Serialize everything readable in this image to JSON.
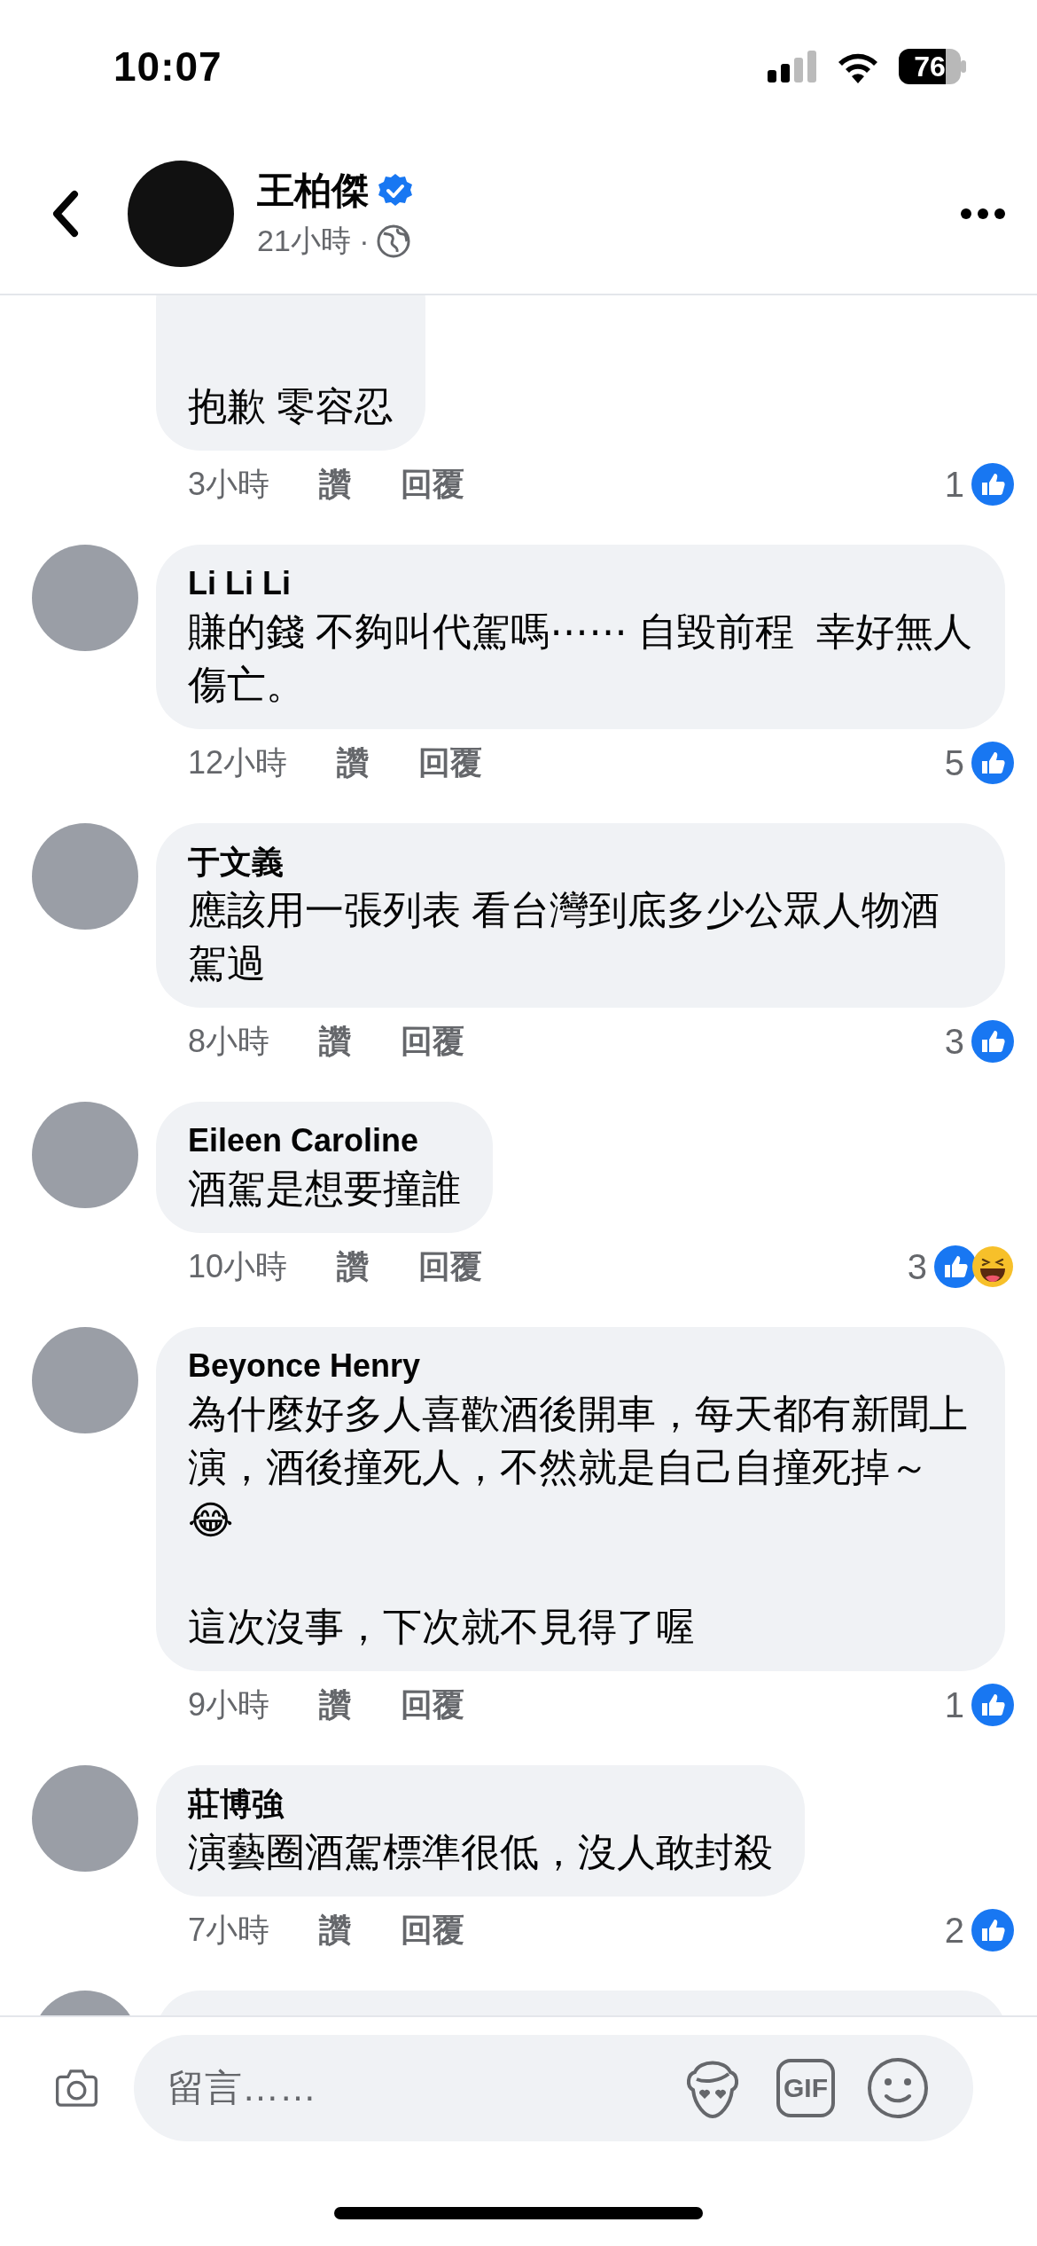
{
  "status_bar": {
    "time": "10:07",
    "battery": "76"
  },
  "post_header": {
    "author": "王柏傑",
    "verified": true,
    "time": "21小時 ·"
  },
  "comments": [
    {
      "kind": "cut_top",
      "text": "抱歉 零容忍",
      "time": "3小時",
      "like_label": "讚",
      "reply_label": "回覆",
      "reaction_count": "1",
      "reactions": [
        {
          "kind": "like"
        }
      ]
    },
    {
      "kind": "comment",
      "author": "Li Li Li",
      "text": "賺的錢 不夠叫代駕嗎⋯⋯ 自毀前程  幸好無人傷亡。",
      "time": "12小時",
      "like_label": "讚",
      "reply_label": "回覆",
      "reaction_count": "5",
      "reactions": [
        {
          "kind": "like"
        }
      ]
    },
    {
      "kind": "comment",
      "author": "于文義",
      "text": "應該用一張列表 看台灣到底多少公眾人物酒駕過",
      "time": "8小時",
      "like_label": "讚",
      "reply_label": "回覆",
      "reaction_count": "3",
      "reactions": [
        {
          "kind": "like"
        }
      ]
    },
    {
      "kind": "comment",
      "author": "Eileen Caroline",
      "text": "酒駕是想要撞誰",
      "time": "10小時",
      "like_label": "讚",
      "reply_label": "回覆",
      "reaction_count": "3",
      "reactions": [
        {
          "kind": "like"
        },
        {
          "kind": "haha"
        }
      ]
    },
    {
      "kind": "comment",
      "author": "Beyonce Henry",
      "text": "為什麼好多人喜歡酒後開車，每天都有新聞上演，酒後撞死人，不然就是自己自撞死掉～\n😂\n\n這次沒事，下次就不見得了喔",
      "time": "9小時",
      "like_label": "讚",
      "reply_label": "回覆",
      "reaction_count": "1",
      "reactions": [
        {
          "kind": "like"
        }
      ]
    },
    {
      "kind": "comment",
      "author": "莊博強",
      "text": "演藝圈酒駕標準很低，沒人敢封殺",
      "time": "7小時",
      "like_label": "讚",
      "reply_label": "回覆",
      "reaction_count": "2",
      "reactions": [
        {
          "kind": "like"
        }
      ]
    },
    {
      "kind": "cut_bottom"
    }
  ],
  "composer": {
    "placeholder": "留言……",
    "gif_label": "GIF"
  }
}
